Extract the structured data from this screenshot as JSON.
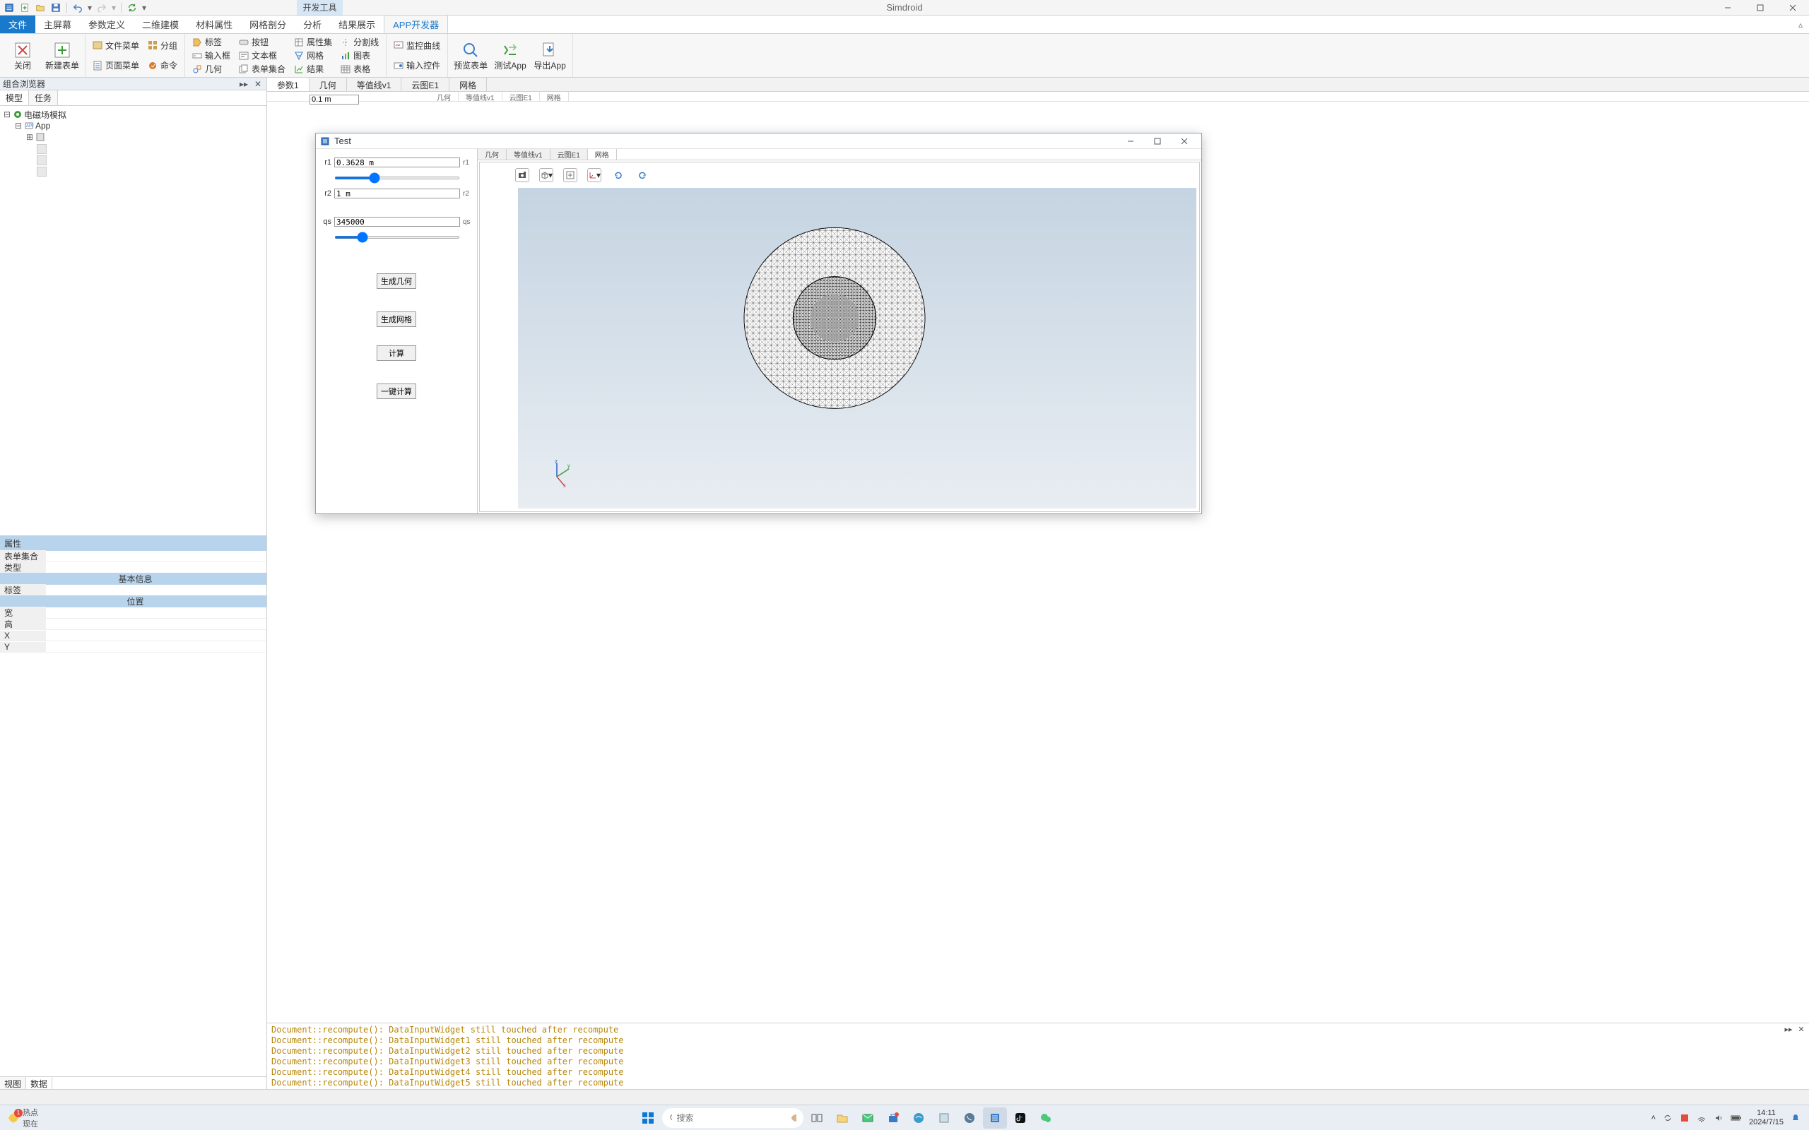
{
  "app_title": "Simdroid",
  "titlebar_highlight": "开发工具",
  "ribbon_tabs": {
    "file": "文件",
    "items": [
      "主屏幕",
      "参数定义",
      "二维建模",
      "材料属性",
      "网格剖分",
      "分析",
      "结果展示",
      "APP开发器"
    ],
    "active_index": 7
  },
  "ribbon": {
    "close": "关闭",
    "new_form": "新建表单",
    "file_menu": "文件菜单",
    "page_menu": "页面菜单",
    "group": "分组",
    "command": "命令",
    "label": "标签",
    "input_box": "输入框",
    "geometry": "几何",
    "button": "按钮",
    "text_box": "文本框",
    "form_collection": "表单集合",
    "property_set": "属性集",
    "mesh": "网格",
    "result": "结果",
    "split_line": "分割线",
    "chart": "图表",
    "table": "表格",
    "monitor_curve": "监控曲线",
    "input_control": "输入控件",
    "preview_form": "预览表单",
    "test_app": "测试App",
    "export_app": "导出App"
  },
  "left_panel": {
    "header": "组合浏览器",
    "tabs": [
      "模型",
      "任务"
    ],
    "active_tab": 0,
    "tree_root": "电磁场模拟",
    "tree_app": "App"
  },
  "properties": {
    "header": "属性",
    "rows": [
      "表单集合",
      "类型"
    ],
    "section_basic": "基本信息",
    "row_label": "标签",
    "section_pos": "位置",
    "row_w": "宽",
    "row_h": "高",
    "row_x": "X",
    "row_y": "Y"
  },
  "bottom_tabs": [
    "视图",
    "数据"
  ],
  "bottom_active": 1,
  "doc_tabs": [
    "参数1",
    "几何",
    "等值线v1",
    "云图E1",
    "网格"
  ],
  "doc_active": 0,
  "inner_tabs": [
    "几何",
    "等值线v1",
    "云图E1",
    "网格"
  ],
  "bg_field_value": "0.1 m",
  "dialog": {
    "title": "Test",
    "params": {
      "r1": {
        "label": "r1",
        "value": "0.3628 m",
        "unit": "r1"
      },
      "r2": {
        "label": "r2",
        "value": "1 m",
        "unit": "r2"
      },
      "qs": {
        "label": "qs",
        "value": "345000",
        "unit": "qs"
      }
    },
    "actions": {
      "gen_geom": "生成几何",
      "gen_mesh": "生成网格",
      "compute": "计算",
      "one_click": "一键计算"
    },
    "tabs": [
      "几何",
      "等值线v1",
      "云图E1",
      "网格"
    ],
    "active_tab": 3
  },
  "log_lines": [
    "Document::recompute(): DataInputWidget still touched after recompute",
    "Document::recompute(): DataInputWidget1 still touched after recompute",
    "Document::recompute(): DataInputWidget2 still touched after recompute",
    "Document::recompute(): DataInputWidget3 still touched after recompute",
    "Document::recompute(): DataInputWidget4 still touched after recompute",
    "Document::recompute(): DataInputWidget5 still touched after recompute"
  ],
  "taskbar": {
    "weather_label1": "热点",
    "weather_label2": "现在",
    "weather_badge": "1",
    "search_placeholder": "搜索",
    "time": "14:11",
    "date": "2024/7/15"
  }
}
